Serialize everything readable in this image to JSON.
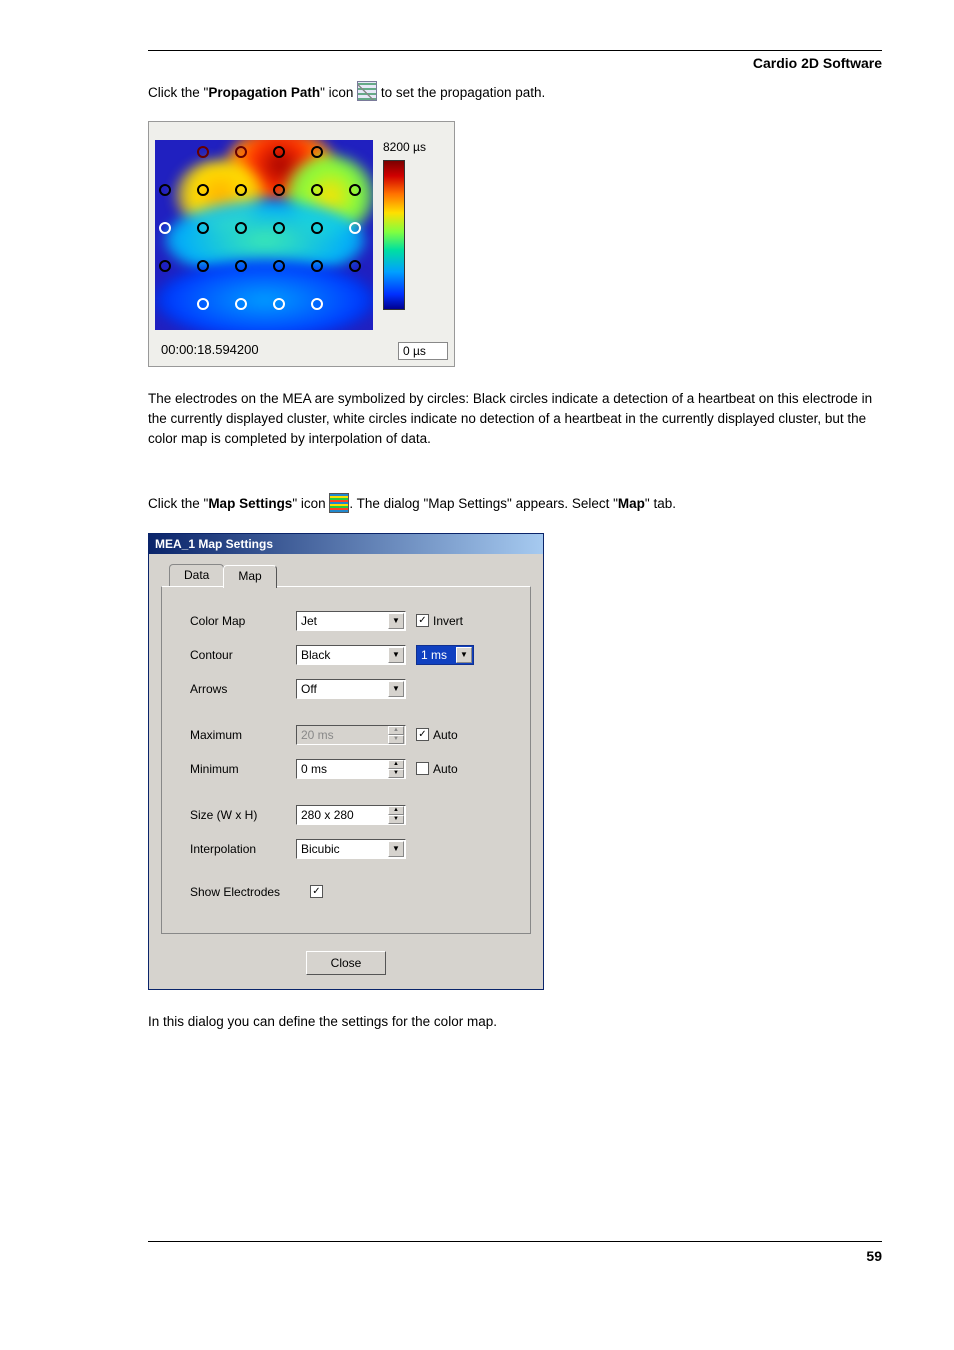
{
  "header": {
    "title": "Cardio 2D Software"
  },
  "p1": {
    "pre": "Click the \"",
    "term": "Propagation Path",
    "mid": "\" icon ",
    "post": " to set the propagation path."
  },
  "heatmap": {
    "top_label": "8200 µs",
    "bottom_label": "0 µs",
    "timestamp": "00:00:18.594200"
  },
  "p2": "The electrodes on the MEA are symbolized by circles: Black circles indicate a detection of a heartbeat on this electrode in the currently displayed cluster, white circles indicate no detection of a heartbeat in the currently displayed cluster, but the color map is completed by interpolation of data.",
  "p3": {
    "pre": "Click the \"",
    "term": "Map Settings",
    "mid": "\" icon ",
    "post1": ". The dialog \"Map Settings\" appears. Select \"",
    "term2": "Map",
    "post2": "\" tab."
  },
  "dialog": {
    "title": "MEA_1  Map Settings",
    "tabs": {
      "data": "Data",
      "map": "Map"
    },
    "labels": {
      "colormap": "Color Map",
      "contour": "Contour",
      "arrows": "Arrows",
      "maximum": "Maximum",
      "minimum": "Minimum",
      "size": "Size (W x H)",
      "interpolation": "Interpolation",
      "show_electrodes": "Show Electrodes"
    },
    "values": {
      "colormap": "Jet",
      "contour": "Black",
      "arrows": "Off",
      "maximum": "20 ms",
      "minimum": "0 ms",
      "size": "280 x 280",
      "interpolation": "Bicubic",
      "contour_step": "1 ms"
    },
    "checks": {
      "invert": "Invert",
      "auto1": "Auto",
      "auto2": "Auto"
    },
    "close": "Close"
  },
  "p4": "In this dialog you can define the settings for the color map.",
  "page_number": "59",
  "chart_data": {
    "type": "heatmap",
    "title": "Propagation map",
    "colorscale": "Jet (inverted)",
    "colorbar": {
      "min_label": "0 µs",
      "max_label": "8200 µs",
      "unit": "µs",
      "range": [
        0,
        8200
      ]
    },
    "timestamp": "00:00:18.594200",
    "grid": "6x6 electrode array with missing corners",
    "note": "High values (red) concentrated in upper-central region; low values (blue) toward lower region. Circles mark electrodes: black ring = detected, white ring = not detected (interpolated)."
  }
}
